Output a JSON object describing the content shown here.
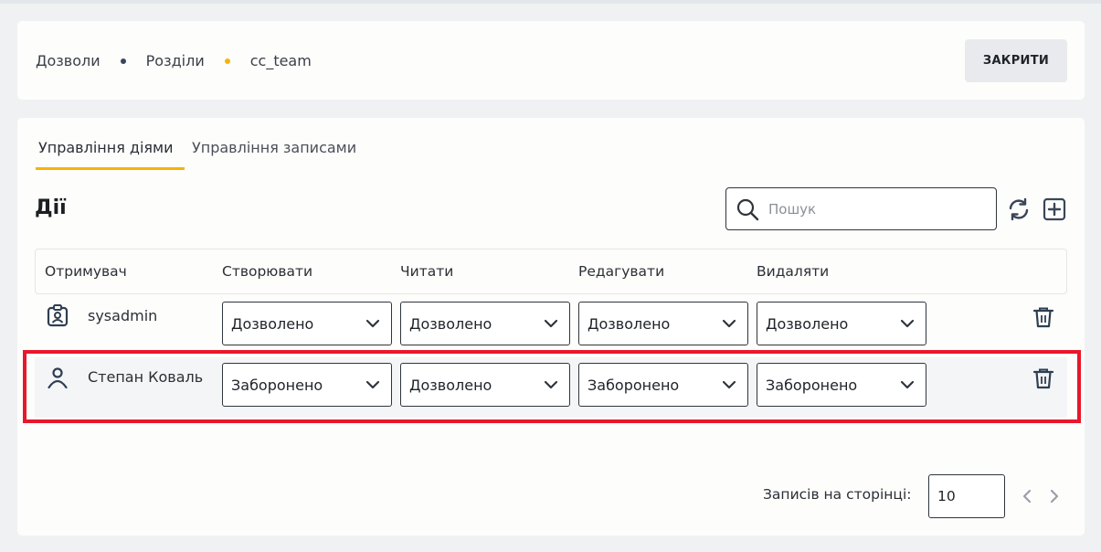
{
  "breadcrumb": {
    "items": [
      "Дозволи",
      "Розділи",
      "cc_team"
    ]
  },
  "header": {
    "close_label": "ЗАКРИТИ"
  },
  "tabs": [
    {
      "label": "Управління діями",
      "active": true
    },
    {
      "label": "Управління записами",
      "active": false
    }
  ],
  "section": {
    "title": "Дії"
  },
  "search": {
    "placeholder": "Пошук",
    "value": ""
  },
  "table": {
    "columns": [
      "Отримувач",
      "Створювати",
      "Читати",
      "Редагувати",
      "Видаляти"
    ],
    "rows": [
      {
        "name": "sysadmin",
        "icon": "badge-user-icon",
        "create": "Дозволено",
        "read": "Дозволено",
        "edit": "Дозволено",
        "delete": "Дозволено"
      },
      {
        "name": "Степан Коваль",
        "icon": "person-icon",
        "create": "Заборонено",
        "read": "Дозволено",
        "edit": "Заборонено",
        "delete": "Заборонено"
      }
    ]
  },
  "pagination": {
    "label": "Записів на сторінці:",
    "per_page": "10"
  },
  "colors": {
    "accent": "#f5b400",
    "highlight": "#e8172b",
    "border": "#2f353d"
  }
}
